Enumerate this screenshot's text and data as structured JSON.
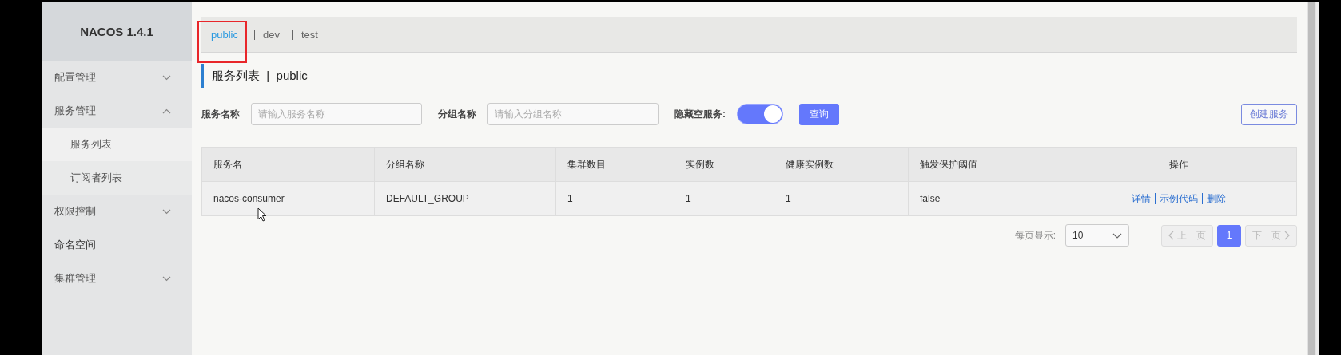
{
  "sidebar": {
    "title": "NACOS 1.4.1",
    "items": [
      {
        "label": "配置管理",
        "kind": "group",
        "expanded": false
      },
      {
        "label": "服务管理",
        "kind": "group",
        "expanded": true,
        "children": [
          {
            "label": "服务列表",
            "selected": true
          },
          {
            "label": "订阅者列表",
            "selected": false
          }
        ]
      },
      {
        "label": "权限控制",
        "kind": "group",
        "expanded": false
      },
      {
        "label": "命名空间",
        "kind": "link"
      },
      {
        "label": "集群管理",
        "kind": "group",
        "expanded": false
      }
    ]
  },
  "namespace_tabs": [
    {
      "label": "public",
      "selected": true
    },
    {
      "label": "dev",
      "selected": false
    },
    {
      "label": "test",
      "selected": false
    }
  ],
  "page_title": "服务列表  |  public",
  "filters": {
    "service_name": {
      "label": "服务名称",
      "placeholder": "请输入服务名称"
    },
    "group_name": {
      "label": "分组名称",
      "placeholder": "请输入分组名称"
    },
    "hide_empty": {
      "label": "隐藏空服务:",
      "on": true
    },
    "query_button": "查询",
    "create_button": "创建服务"
  },
  "table": {
    "columns": [
      "服务名",
      "分组名称",
      "集群数目",
      "实例数",
      "健康实例数",
      "触发保护阈值",
      "操作"
    ],
    "rows": [
      {
        "cells": [
          "nacos-consumer",
          "DEFAULT_GROUP",
          "1",
          "1",
          "1",
          "false"
        ],
        "actions": [
          "详情",
          "示例代码",
          "删除"
        ]
      }
    ]
  },
  "pagination": {
    "page_size_label": "每页显示:",
    "page_size": "10",
    "prev": {
      "label": "上一页",
      "disabled": true
    },
    "pages": [
      {
        "label": "1",
        "selected": true
      }
    ],
    "next": {
      "label": "下一页",
      "disabled": true
    }
  }
}
